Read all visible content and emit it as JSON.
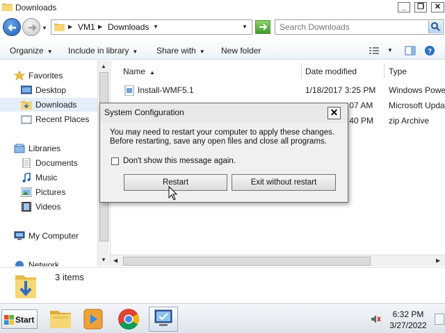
{
  "window": {
    "title": "Downloads"
  },
  "address": {
    "crumbs": [
      "VM1",
      "Downloads"
    ],
    "search_placeholder": "Search Downloads"
  },
  "toolbar": {
    "organize": "Organize",
    "include_in_library": "Include in library",
    "share_with": "Share with",
    "new_folder": "New folder"
  },
  "nav": {
    "favorites": "Favorites",
    "desktop": "Desktop",
    "downloads": "Downloads",
    "recent_places": "Recent Places",
    "libraries": "Libraries",
    "documents": "Documents",
    "music": "Music",
    "pictures": "Pictures",
    "videos": "Videos",
    "my_computer": "My Computer",
    "network": "Network"
  },
  "columns": {
    "name": "Name",
    "date_modified": "Date modified",
    "type": "Type"
  },
  "files": [
    {
      "name": "Install-WMF5.1",
      "date": "1/18/2017 3:25 PM",
      "type": "Windows Powe"
    },
    {
      "name": "",
      "date": ":07 AM",
      "type": "Microsoft Upda"
    },
    {
      "name": "",
      "date": ":40 PM",
      "type": "zip Archive"
    }
  ],
  "details": {
    "item_count": "3 items"
  },
  "dialog": {
    "title": "System Configuration",
    "message_line1": "You may need to restart your computer to apply these changes.",
    "message_line2": "Before restarting, save any open files and close all programs.",
    "checkbox_label": "Don't show this message again.",
    "restart_label": "Restart",
    "exit_label": "Exit without restart"
  },
  "taskbar": {
    "start_label": "Start",
    "time": "6:32 PM",
    "date": "3/27/2022"
  },
  "colors": {
    "selection": "#e5eef9",
    "folder_yellow": "#f3cf63",
    "accent_blue": "#1f5fb4"
  }
}
